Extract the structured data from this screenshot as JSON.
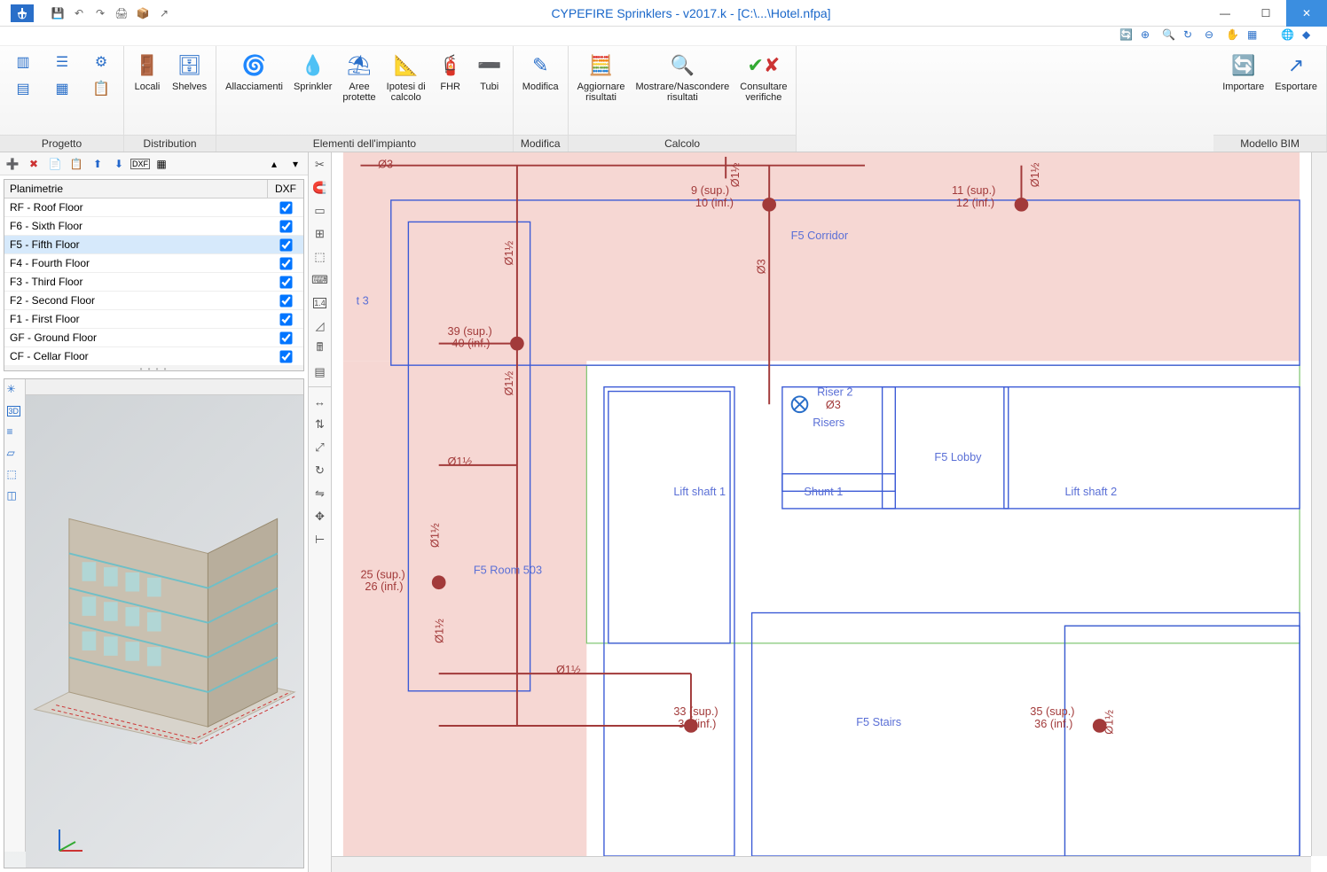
{
  "window": {
    "title": "CYPEFIRE Sprinklers - v2017.k - [C:\\...\\Hotel.nfpa]"
  },
  "ribbon": {
    "groups": {
      "progetto": {
        "label": "Progetto"
      },
      "distribution": {
        "label": "Distribution",
        "locali": "Locali",
        "shelves": "Shelves"
      },
      "elementi": {
        "label": "Elementi dell'impianto",
        "allacciamenti": "Allacciamenti",
        "sprinkler": "Sprinkler",
        "aree": "Aree\nprotette",
        "ipotesi": "Ipotesi di\ncalcolo",
        "fhr": "FHR",
        "tubi": "Tubi"
      },
      "modifica": {
        "label": "Modifica",
        "modifica": "Modifica"
      },
      "calcolo": {
        "label": "Calcolo",
        "aggiornare": "Aggiornare\nrisultati",
        "mostrare": "Mostrare/Nascondere\nrisultati",
        "consultare": "Consultare\nverifiche"
      },
      "bim": {
        "label": "Modello BIM",
        "importare": "Importare",
        "esportare": "Esportare"
      }
    }
  },
  "floorplans": {
    "header": {
      "name": "Planimetrie",
      "dxf": "DXF"
    },
    "rows": [
      {
        "name": "RF - Roof Floor",
        "dxf": true,
        "selected": false
      },
      {
        "name": "F6 - Sixth Floor",
        "dxf": true,
        "selected": false
      },
      {
        "name": "F5 - Fifth Floor",
        "dxf": true,
        "selected": true
      },
      {
        "name": "F4 - Fourth Floor",
        "dxf": true,
        "selected": false
      },
      {
        "name": "F3 - Third Floor",
        "dxf": true,
        "selected": false
      },
      {
        "name": "F2 - Second Floor",
        "dxf": true,
        "selected": false
      },
      {
        "name": "F1 - First Floor",
        "dxf": true,
        "selected": false
      },
      {
        "name": "GF - Ground Floor",
        "dxf": true,
        "selected": false
      },
      {
        "name": "CF - Cellar Floor",
        "dxf": true,
        "selected": false
      }
    ]
  },
  "drawing": {
    "rooms": {
      "corridor": "F5 Corridor",
      "lift1": "Lift shaft 1",
      "shunt1": "Shunt 1",
      "lobby": "F5 Lobby",
      "lift2": "Lift shaft 2",
      "room503": "F5 Room 503",
      "stairs": "F5 Stairs",
      "risers": "Risers",
      "riser2": "Riser 2",
      "t3": "t 3"
    },
    "pipes": {
      "o3a": "Ø3",
      "o3b": "Ø3",
      "o3c": "Ø3",
      "o112a": "Ø1½",
      "o112b": "Ø1½",
      "o112c": "Ø1½",
      "o112d": "Ø1½",
      "o112e": "Ø1½",
      "o112f": "Ø1½",
      "o112g": "Ø1½",
      "o112h": "Ø1½",
      "o112i": "Ø1½"
    },
    "nodes": {
      "n9": "9 (sup.)",
      "n10": "10 (inf.)",
      "n11": "11 (sup.)",
      "n12": "12 (inf.)",
      "n39": "39 (sup.)",
      "n40": "40 (inf.)",
      "n25": "25 (sup.)",
      "n26": "26 (inf.)",
      "n33": "33 (sup.)",
      "n34": "34 (inf.)",
      "n35": "35 (sup.)",
      "n36": "36 (inf.)"
    }
  }
}
